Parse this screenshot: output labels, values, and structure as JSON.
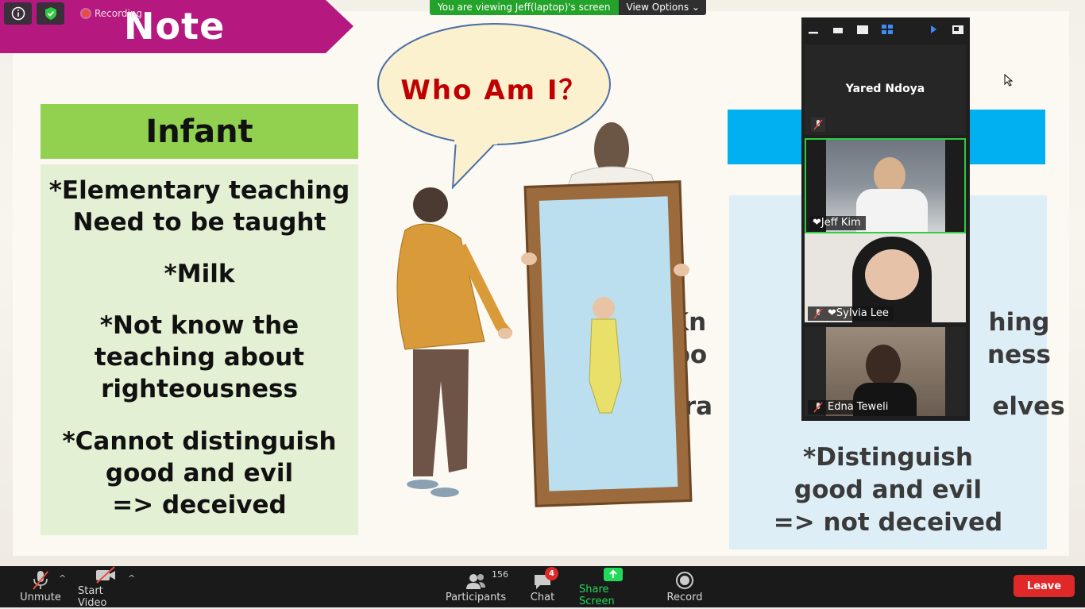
{
  "slide": {
    "title": "Note",
    "bubble_text": "Who Am I？",
    "infant": {
      "heading": "Infant",
      "lines": [
        "*Elementary teaching",
        "Need to be taught",
        "*Milk",
        "*Not know the",
        "teaching about",
        "righteousness",
        "*Cannot distinguish",
        "good and evil",
        "=> deceived"
      ]
    },
    "right_panel": {
      "lines": [
        "*Kn",
        "hing",
        "abo",
        "ness",
        "*Tra",
        "elves",
        "*Distinguish",
        "good and evil",
        "=> not deceived"
      ]
    }
  },
  "top": {
    "recording_label": "Recording",
    "viewing_text": "You are viewing Jeff(laptop)'s screen",
    "view_options": "View Options"
  },
  "gallery": {
    "participants": [
      {
        "name": "Yared Ndoya"
      },
      {
        "name": "❤Jeff Kim"
      },
      {
        "name": "❤Sylvia Lee"
      },
      {
        "name": "Edna Teweli"
      }
    ]
  },
  "bottombar": {
    "unmute": "Unmute",
    "start_video": "Start Video",
    "participants": "Participants",
    "participants_count": "156",
    "chat": "Chat",
    "chat_badge": "4",
    "share_screen": "Share Screen",
    "record": "Record",
    "leave": "Leave"
  },
  "colors": {
    "banner": "#b5197f",
    "infant_green": "#92d050",
    "right_blue": "#00b0f0",
    "share_green": "#23d959",
    "leave_red": "#e02828"
  }
}
